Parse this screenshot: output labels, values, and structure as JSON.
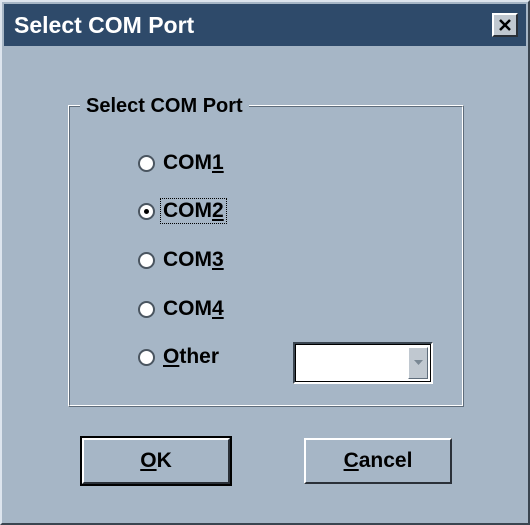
{
  "window": {
    "title": "Select COM Port"
  },
  "group": {
    "legend": "Select COM Port"
  },
  "options": [
    {
      "prefix": "COM",
      "accel": "1",
      "suffix": "",
      "checked": false
    },
    {
      "prefix": "COM",
      "accel": "2",
      "suffix": "",
      "checked": true
    },
    {
      "prefix": "COM",
      "accel": "3",
      "suffix": "",
      "checked": false
    },
    {
      "prefix": "COM",
      "accel": "4",
      "suffix": "",
      "checked": false
    },
    {
      "prefix": "",
      "accel": "O",
      "suffix": "ther",
      "checked": false
    }
  ],
  "other_combo": {
    "value": ""
  },
  "buttons": {
    "ok_accel": "O",
    "ok_rest": "K",
    "cancel_accel": "C",
    "cancel_rest": "ancel"
  },
  "icons": {
    "close": "close-icon",
    "dropdown": "chevron-down-icon"
  },
  "colors": {
    "titlebar": "#2e4a6a",
    "window_bg": "#a6b6c6"
  }
}
